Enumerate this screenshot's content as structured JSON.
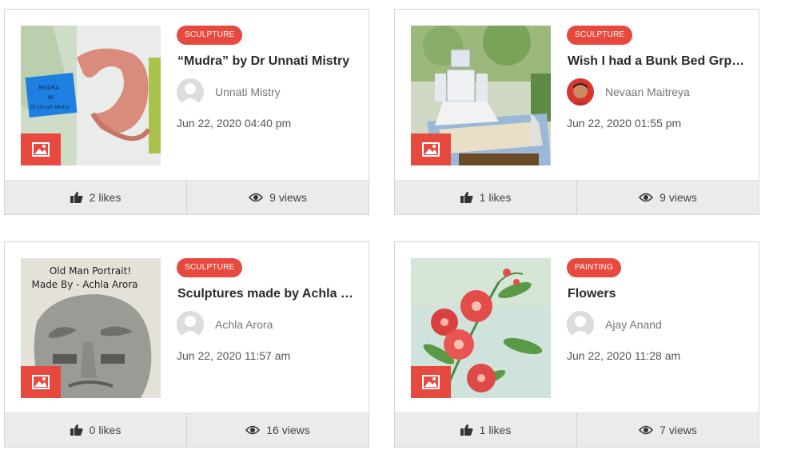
{
  "cards": [
    {
      "category": "SCULPTURE",
      "title": "“Mudra” by Dr Unnati Mistry",
      "author": "Unnati Mistry",
      "date": "Jun 22, 2020 04:40 pm",
      "likes": "2 likes",
      "views": "9 views",
      "image_text": [
        "MUDRA",
        "BY",
        "Dr Unnati Mistry"
      ]
    },
    {
      "category": "SCULPTURE",
      "title": "Wish I had a Bunk Bed Grp…",
      "author": "Nevaan Maitreya",
      "date": "Jun 22, 2020 01:55 pm",
      "likes": "1 likes",
      "views": "9 views"
    },
    {
      "category": "SCULPTURE",
      "title": "Sculptures made by Achla …",
      "author": "Achla Arora",
      "date": "Jun 22, 2020 11:57 am",
      "likes": "0 likes",
      "views": "16 views",
      "image_text": [
        "Old Man Portrait!",
        "Made By - Achla Arora"
      ]
    },
    {
      "category": "PAINTING",
      "title": "Flowers",
      "author": "Ajay Anand",
      "date": "Jun 22, 2020 11:28 am",
      "likes": "1 likes",
      "views": "7 views"
    }
  ],
  "colors": {
    "accent": "#e8493e",
    "footer": "#ebebeb"
  },
  "icons": {
    "image_badge": "image-icon",
    "likes": "thumbs-up-icon",
    "views": "eye-icon",
    "avatar": "user-avatar-icon"
  }
}
